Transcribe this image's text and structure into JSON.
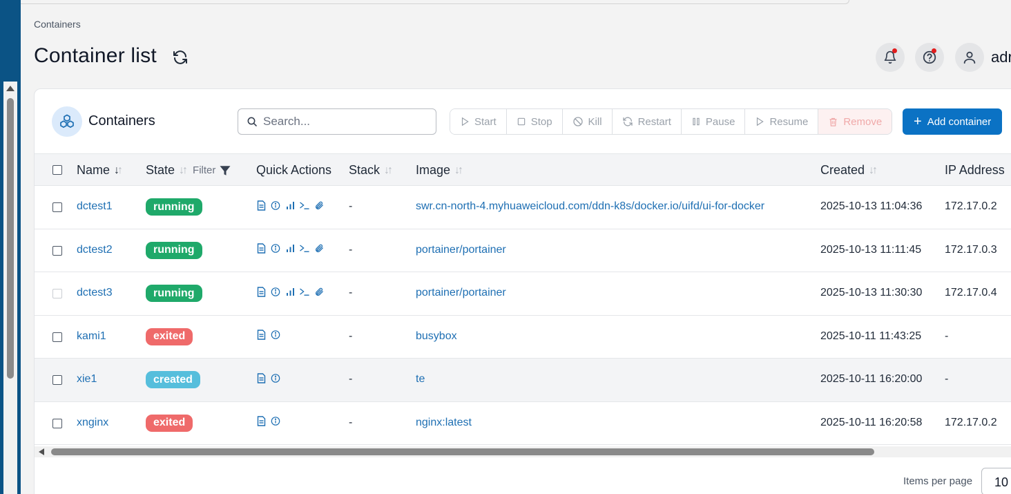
{
  "breadcrumb": "Containers",
  "page_title": "Container list",
  "header": {
    "user_label": "adr"
  },
  "card": {
    "title": "Containers",
    "search_placeholder": "Search...",
    "actions": {
      "start": "Start",
      "stop": "Stop",
      "kill": "Kill",
      "restart": "Restart",
      "pause": "Pause",
      "resume": "Resume",
      "remove": "Remove"
    },
    "add_label": "Add container"
  },
  "table": {
    "columns": {
      "name": "Name",
      "state": "State",
      "filter": "Filter",
      "quick_actions": "Quick Actions",
      "stack": "Stack",
      "image": "Image",
      "created": "Created",
      "ip": "IP Address"
    },
    "rows": [
      {
        "name": "dctest1",
        "state": "running",
        "stack": "-",
        "image": "swr.cn-north-4.myhuaweicloud.com/ddn-k8s/docker.io/uifd/ui-for-docker",
        "created": "2025-10-13 11:04:36",
        "ip": "172.17.0.2"
      },
      {
        "name": "dctest2",
        "state": "running",
        "stack": "-",
        "image": "portainer/portainer",
        "created": "2025-10-13 11:11:45",
        "ip": "172.17.0.3"
      },
      {
        "name": "dctest3",
        "state": "running",
        "stack": "-",
        "image": "portainer/portainer",
        "created": "2025-10-13 11:30:30",
        "ip": "172.17.0.4"
      },
      {
        "name": "kami1",
        "state": "exited",
        "stack": "-",
        "image": "busybox",
        "created": "2025-10-11 11:43:25",
        "ip": "-"
      },
      {
        "name": "xie1",
        "state": "created",
        "stack": "-",
        "image": "te",
        "created": "2025-10-11 16:20:00",
        "ip": "-"
      },
      {
        "name": "xnginx",
        "state": "exited",
        "stack": "-",
        "image": "nginx:latest",
        "created": "2025-10-11 16:20:58",
        "ip": "172.17.0.2"
      }
    ]
  },
  "pagination": {
    "items_per_page_label": "Items per page",
    "items_per_page_value": "10"
  },
  "colors": {
    "primary": "#0b72c4",
    "running": "#1fa96a",
    "exited": "#ef6a6a",
    "created": "#56bedc",
    "link": "#1e6fb3"
  }
}
